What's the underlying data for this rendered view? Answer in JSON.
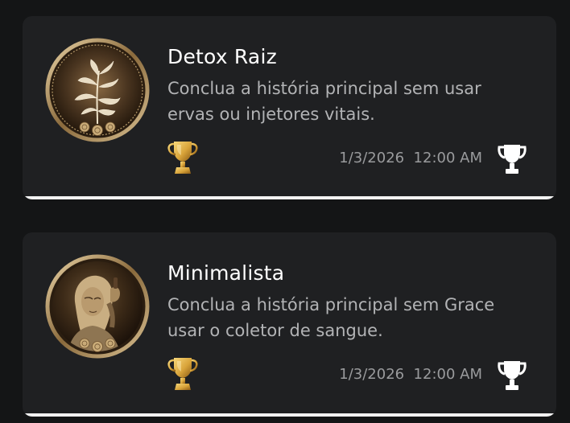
{
  "trophies": [
    {
      "title": "Detox Raiz",
      "description": "Conclua a história principal sem usar ervas ou injetores vitais.",
      "date": "1/3/2026  12:00 AM",
      "grade_icon": "gold-trophy-icon",
      "status_icon": "trophy-icon"
    },
    {
      "title": "Minimalista",
      "description": "Conclua a história principal sem Grace usar o coletor de sangue.",
      "date": "1/3/2026  12:00 AM",
      "grade_icon": "gold-trophy-icon",
      "status_icon": "trophy-icon"
    }
  ],
  "colors": {
    "background": "#141516",
    "card": "#1f2022",
    "gold": "#d9a43a",
    "title_text": "#ffffff",
    "desc_text": "#b2b3b5"
  }
}
